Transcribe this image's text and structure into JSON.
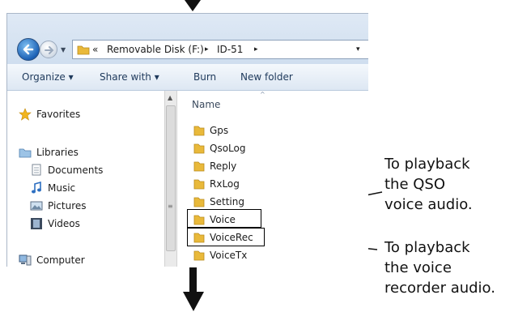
{
  "address": {
    "chevron": "«",
    "crumbs": [
      "Removable Disk (F:)",
      "ID-51"
    ],
    "separator": "▸",
    "dropdown": "▾"
  },
  "toolbar": {
    "organize": "Organize ▾",
    "share_with": "Share with ▾",
    "burn": "Burn",
    "new_folder": "New folder"
  },
  "nav_pane": {
    "favorites": "Favorites",
    "libraries": "Libraries",
    "documents": "Documents",
    "music": "Music",
    "pictures": "Pictures",
    "videos": "Videos",
    "computer": "Computer"
  },
  "file_list": {
    "column_header": "Name",
    "items": [
      "Gps",
      "QsoLog",
      "Reply",
      "RxLog",
      "Setting",
      "Voice",
      "VoiceRec",
      "VoiceTx"
    ]
  },
  "callouts": {
    "qso": [
      "To playback",
      "the QSO",
      "voice audio."
    ],
    "recorder": [
      "To playback",
      "the voice",
      "recorder audio."
    ]
  },
  "colors": {
    "folder": "#e9b93a",
    "toolbar_text": "#1e395b",
    "highlight_border": "#000000"
  }
}
